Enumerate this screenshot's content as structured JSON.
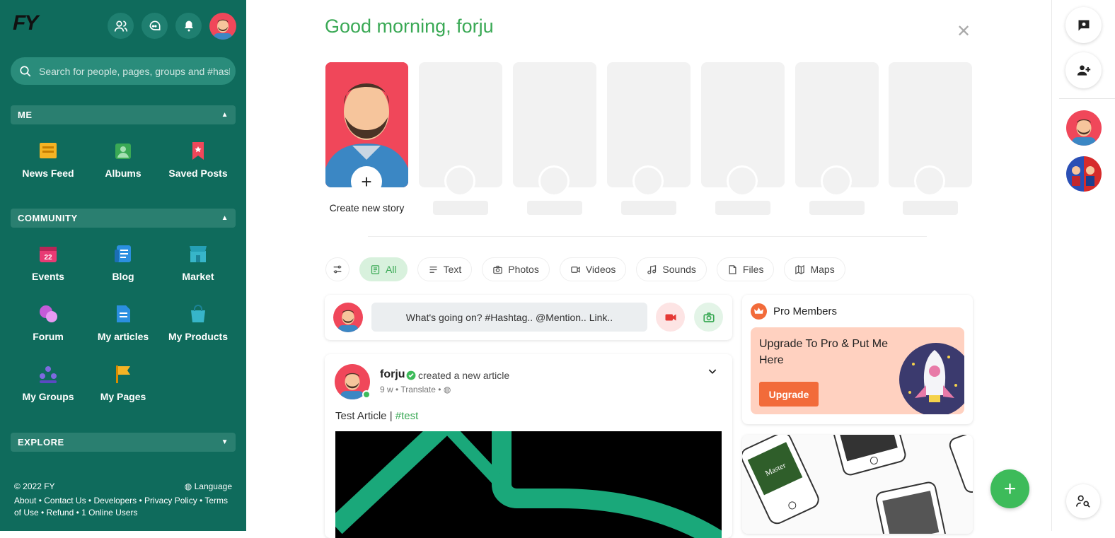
{
  "sidebar": {
    "logo": "FY",
    "search_placeholder": "Search for people, pages, groups and #hashtags",
    "sections": {
      "me": "ME",
      "community": "COMMUNITY",
      "explore": "EXPLORE"
    },
    "me_items": [
      "News Feed",
      "Albums",
      "Saved Posts"
    ],
    "community_items": [
      "Events",
      "Blog",
      "Market",
      "Forum",
      "My articles",
      "My Products",
      "My Groups",
      "My Pages"
    ],
    "footer": {
      "copyright": "© 2022 FY",
      "language": "Language",
      "line2": "About • Contact Us • Developers • Privacy Policy • Terms",
      "line3": "of Use • Refund • 1 Online Users"
    }
  },
  "main": {
    "greeting": "Good morning, forju",
    "create_story": "Create new story",
    "filters": [
      "All",
      "Text",
      "Photos",
      "Videos",
      "Sounds",
      "Files",
      "Maps"
    ],
    "composer_placeholder": "What's going on? #Hashtag.. @Mention.. Link..",
    "post": {
      "author": "forju",
      "action": "created a new article",
      "time": "9 w",
      "translate": "Translate",
      "text": "Test Article | ",
      "hashtag": "#test"
    }
  },
  "pro": {
    "title": "Pro Members",
    "banner_text": "Upgrade To Pro & Put Me Here",
    "button": "Upgrade"
  },
  "colors": {
    "sidebar_bg": "#0f6b5c",
    "accent_green": "#3aa955",
    "pro_orange": "#f26b3a"
  }
}
